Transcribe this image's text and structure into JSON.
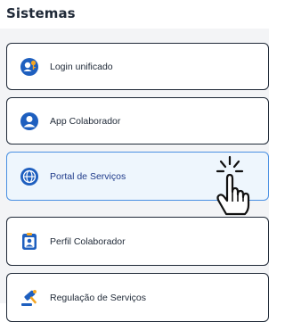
{
  "section": {
    "title": "Sistemas"
  },
  "systems": [
    {
      "label": "Login unificado",
      "icon": "key-person-icon"
    },
    {
      "label": "App Colaborador",
      "icon": "user-icon"
    },
    {
      "label": "Portal de Serviços",
      "icon": "globe-icon"
    },
    {
      "label": "Perfil Colaborador",
      "icon": "id-badge-icon"
    },
    {
      "label": "Regulação de Serviços",
      "icon": "gavel-icon"
    }
  ],
  "colors": {
    "accent": "#1e5fbf",
    "selected_bg": "#eef6fd",
    "selected_border": "#4a90e2"
  },
  "cursor": {
    "icon": "hand-pointer-icon"
  }
}
